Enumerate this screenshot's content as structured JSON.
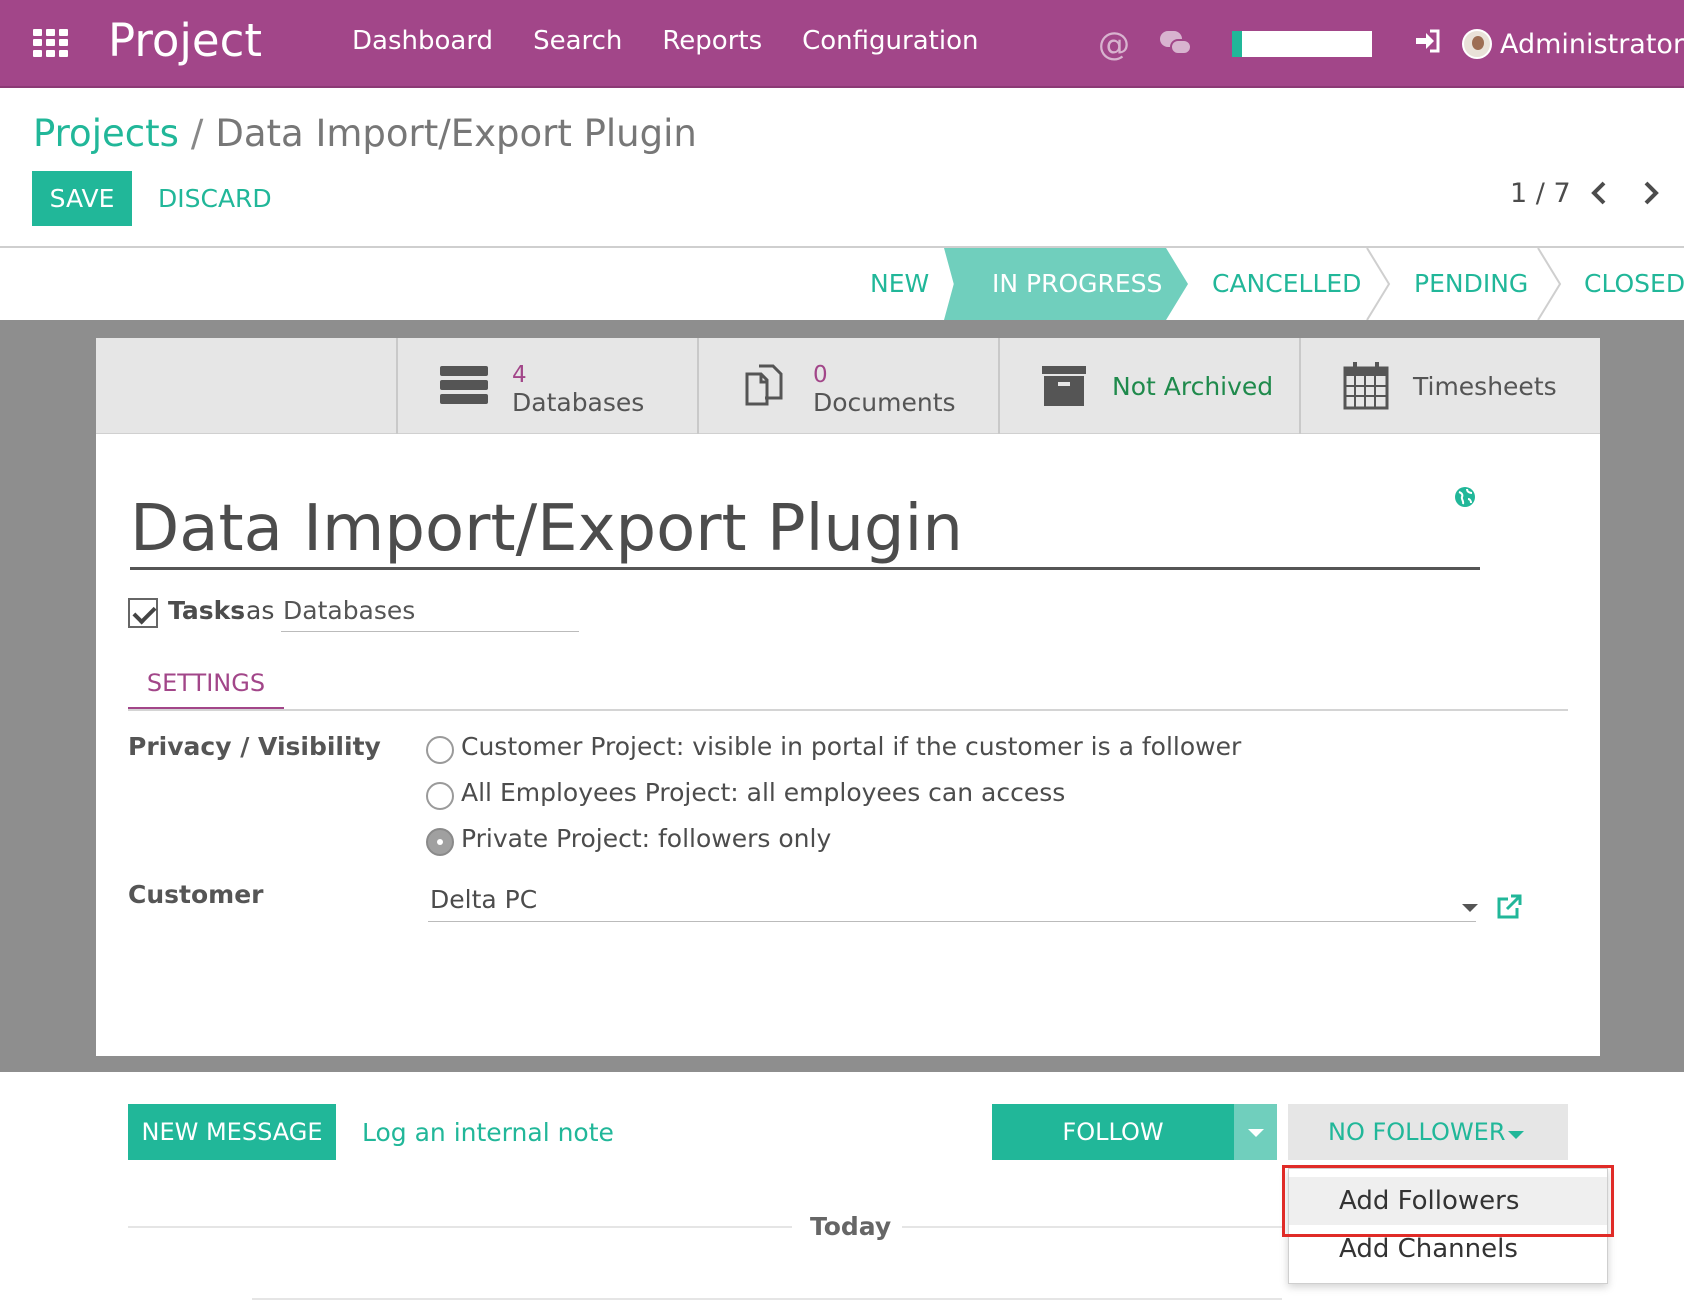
{
  "navbar": {
    "app_name": "Project",
    "menu": [
      "Dashboard",
      "Search",
      "Reports",
      "Configuration"
    ],
    "user": "Administrator"
  },
  "breadcrumb": {
    "parent": "Projects",
    "separator": "/",
    "current": "Data Import/Export Plugin"
  },
  "actions": {
    "save": "SAVE",
    "discard": "DISCARD"
  },
  "pager": {
    "value": "1 / 7"
  },
  "stages": {
    "items": [
      "NEW",
      "IN PROGRESS",
      "CANCELLED",
      "PENDING",
      "CLOSED"
    ],
    "active": "IN PROGRESS"
  },
  "smart_buttons": {
    "databases": {
      "count": "4",
      "label": "Databases"
    },
    "documents": {
      "count": "0",
      "label": "Documents"
    },
    "archive": {
      "label": "Not Archived"
    },
    "timesheets": {
      "label": "Timesheets"
    }
  },
  "form": {
    "title": "Data Import/Export Plugin",
    "tasks_label": "Tasks",
    "as_label": "as",
    "label_tasks_value": "Databases",
    "tab": "SETTINGS",
    "privacy_label": "Privacy / Visibility",
    "privacy_options": [
      "Customer Project: visible in portal if the customer is a follower",
      "All Employees Project: all employees can access",
      "Private Project: followers only"
    ],
    "privacy_selected_index": 2,
    "customer_label": "Customer",
    "customer_value": "Delta PC"
  },
  "chatter": {
    "new_message": "NEW MESSAGE",
    "log_note": "Log an internal note",
    "follow": "FOLLOW",
    "no_follower": "NO FOLLOWER",
    "today": "Today",
    "dropdown": [
      "Add Followers",
      "Add Channels"
    ]
  },
  "colors": {
    "navbar": "#a24689",
    "primary": "#21b799",
    "active_stage": "#70cfbd",
    "highlight": "#e02b27"
  }
}
